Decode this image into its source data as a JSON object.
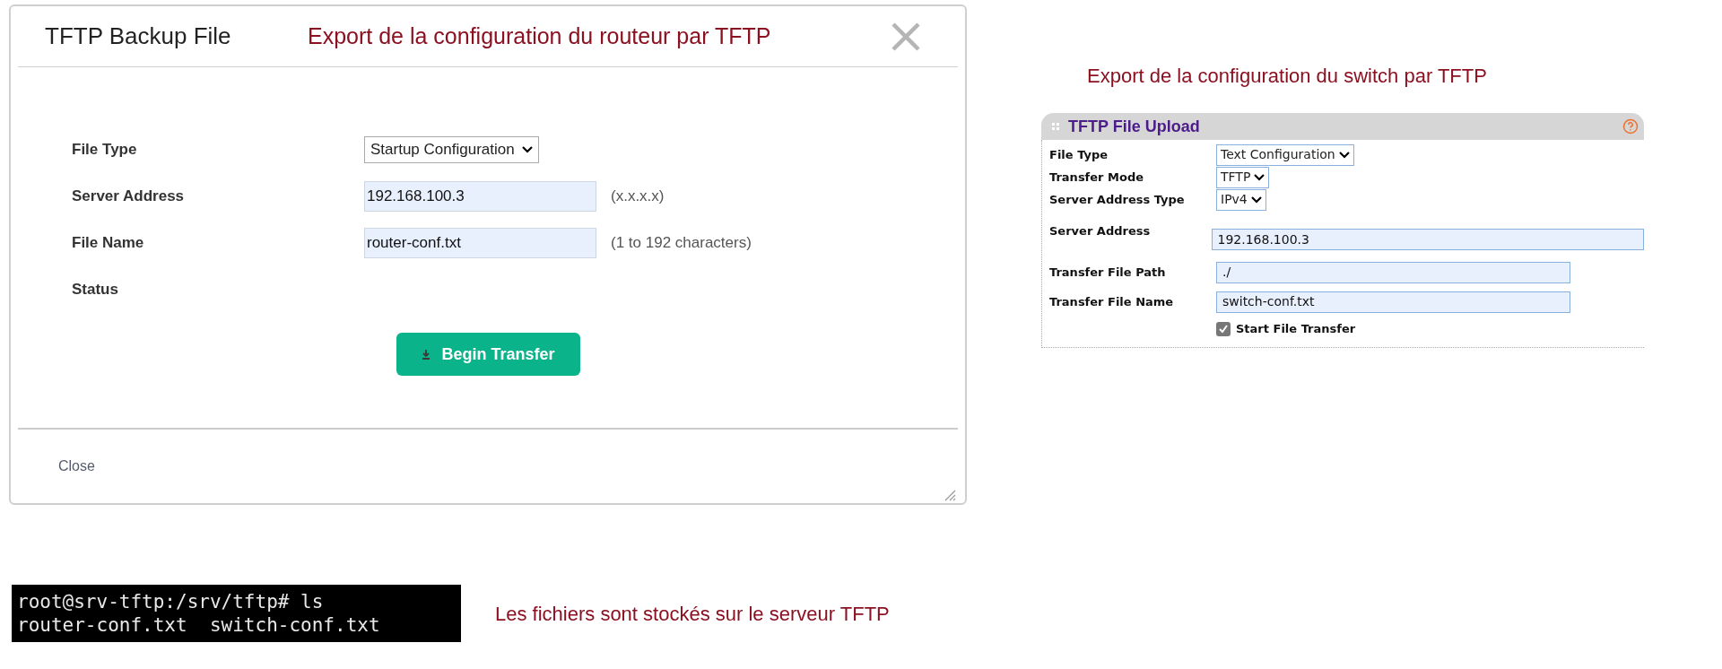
{
  "router_dialog": {
    "title": "TFTP Backup File",
    "caption": "Export de la configuration du routeur par TFTP",
    "fields": [
      {
        "label": "File Type",
        "kind": "select",
        "value": "Startup Configuration"
      },
      {
        "label": "Server Address",
        "kind": "input",
        "value": "192.168.100.3",
        "hint": "(x.x.x.x)"
      },
      {
        "label": "File Name",
        "kind": "input",
        "value": "router-conf.txt",
        "hint": "(1 to 192 characters)"
      },
      {
        "label": "Status",
        "kind": "text"
      }
    ],
    "action_button": "Begin Transfer",
    "footer_button": "Close"
  },
  "switch_panel": {
    "caption": "Export de la configuration du switch par TFTP",
    "title": "TFTP File Upload",
    "fields": [
      {
        "label": "File Type",
        "kind": "select",
        "value": "Text Configuration"
      },
      {
        "label": "Transfer Mode",
        "kind": "select",
        "value": "TFTP"
      },
      {
        "label": "Server Address Type",
        "kind": "select",
        "value": "IPv4"
      },
      {
        "label": "Server Address",
        "kind": "input",
        "value": "192.168.100.3",
        "wide": true
      },
      {
        "label": "Transfer File Path",
        "kind": "input",
        "value": "./"
      },
      {
        "label": "Transfer File Name",
        "kind": "input",
        "value": "switch-conf.txt"
      }
    ],
    "checkbox": {
      "label": "Start File Transfer",
      "checked": true
    }
  },
  "terminal": {
    "lines": [
      "root@srv-tftp:/srv/tftp# ls",
      "router-conf.txt  switch-conf.txt"
    ],
    "caption": "Les fichiers sont stockés sur le serveur TFTP"
  }
}
